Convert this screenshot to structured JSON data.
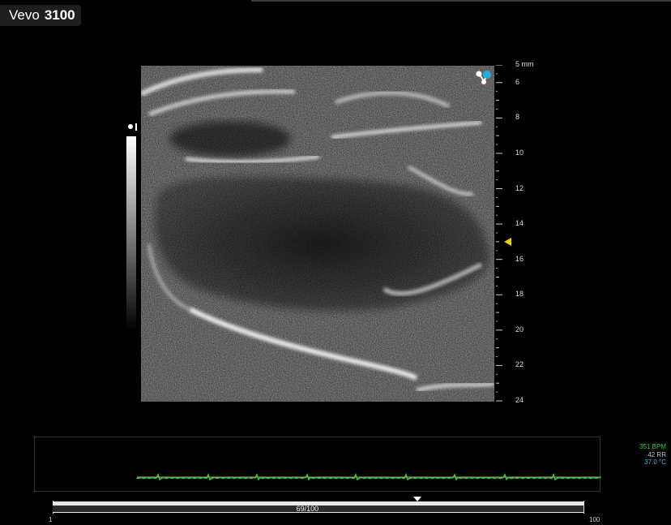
{
  "brand": {
    "name": "Vevo",
    "model": "3100"
  },
  "depth_scale": {
    "unit": "mm",
    "first_label": "5 mm",
    "labels": [
      "6",
      "8",
      "10",
      "12",
      "14",
      "16",
      "18",
      "20",
      "22",
      "24"
    ],
    "focus_depth_mm": 15
  },
  "vitals": {
    "heart_rate": "351 BPM",
    "respiration": "42 RR",
    "temperature": "37.0 °C"
  },
  "frame_slider": {
    "counter": "69/100",
    "min": "1",
    "max": "100",
    "current_fraction": 0.69
  },
  "colors": {
    "background": "#000000",
    "focus_marker": "#f0d000",
    "ecg_trace": "#3cc83c",
    "heart_rate_text": "#3cc83c",
    "temperature_text": "#4db0e0"
  },
  "icons": {
    "view_orientation": "view-orientation-icon",
    "focus_marker": "focus-triangle-icon"
  }
}
